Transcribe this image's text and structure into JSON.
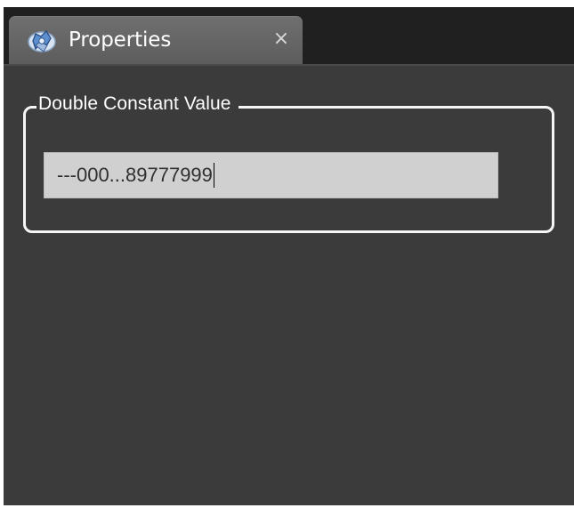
{
  "tab": {
    "title": "Properties",
    "close_glyph": "×",
    "icon": "properties-icon"
  },
  "group": {
    "label": "Double Constant Value"
  },
  "input": {
    "value": "---000...89777999"
  },
  "colors": {
    "tab_background": "#6b6b6b",
    "panel_background": "#3b3b3b",
    "group_border": "#f6f6f6",
    "input_background": "#d0d0d0"
  }
}
